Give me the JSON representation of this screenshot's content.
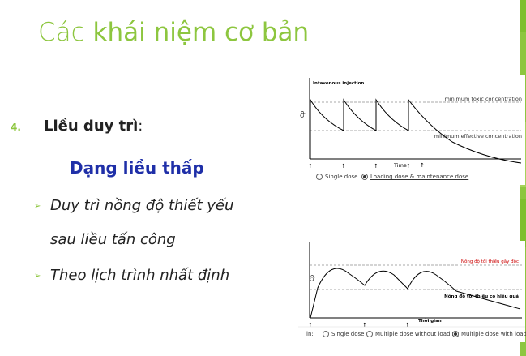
{
  "slide": {
    "title_prefix": "Các ",
    "title_main": "khái niệm cơ bản",
    "item_number": "4.",
    "item_heading": "Liều duy trì",
    "item_colon": ":",
    "sub_heading": "Dạng liều thấp",
    "bullets": [
      {
        "line1": "Duy trì nồng độ thiết yếu",
        "line2": "sau liều tấn công"
      },
      {
        "line1": "Theo lịch trình nhất định"
      }
    ]
  },
  "chart1": {
    "header": "Intavenous injection",
    "top_line_label": "minimum toxic concentration",
    "bottom_line_label": "minimum effective concentration",
    "ylabel": "Cp",
    "xlabel": "Time",
    "options": [
      "Single dose",
      "Loading dose & maintenance dose"
    ],
    "selected_option": "Loading dose & maintenance dose"
  },
  "chart2": {
    "top_line_label": "Nồng độ tối thiểu gây độc",
    "bottom_line_label": "Nồng độ tối thiểu có hiệu quả",
    "ylabel": "Cp",
    "xlabel": "Thời gian",
    "options_prefix": "in:",
    "options": [
      "Single dose",
      "Multiple dose without loading",
      "Multiple dose with loading"
    ],
    "selected_option": "Multiple dose with loading"
  },
  "colors": {
    "accent": "#8dc63f",
    "subheading": "#1f2fa8",
    "chart2_top_label": "#cc0000"
  }
}
